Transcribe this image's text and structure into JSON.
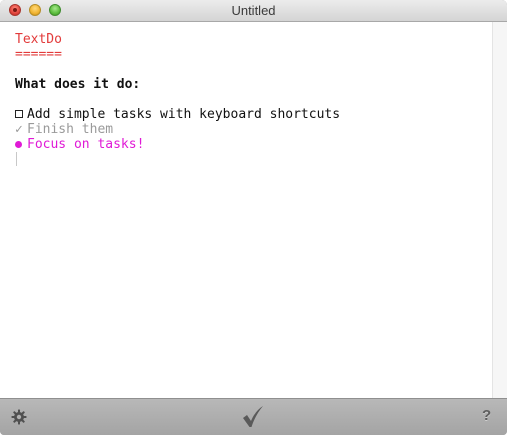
{
  "window": {
    "title": "Untitled"
  },
  "document": {
    "heading": "TextDo",
    "heading_underline": "======",
    "section_title": "What does it do:",
    "tasks": [
      {
        "status": "open",
        "marker_icon": "checkbox-icon",
        "text": "Add simple tasks with keyboard shortcuts"
      },
      {
        "status": "done",
        "marker": "✓",
        "marker_icon": "checkmark-icon",
        "text": "Finish them"
      },
      {
        "status": "focused",
        "marker_icon": "focus-dot-icon",
        "text": "Focus on tasks!"
      }
    ]
  },
  "toolbar": {
    "settings_icon": "gear-icon",
    "complete_icon": "checkmark-icon",
    "help_label": "?"
  },
  "colors": {
    "heading": "#e23a3a",
    "done_text": "#9a9a9a",
    "focus_text": "#e01ad6"
  }
}
